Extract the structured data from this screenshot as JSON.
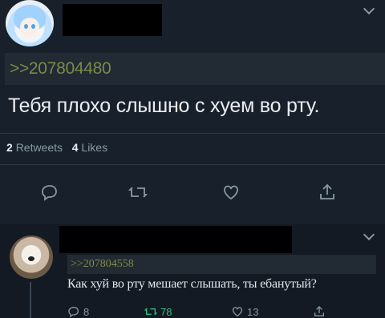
{
  "main_tweet": {
    "quote_ref": ">>207804480",
    "text": "Тебя плохо слышно с хуем во рту.",
    "retweets_count": "2",
    "retweets_label": "Retweets",
    "likes_count": "4",
    "likes_label": "Likes"
  },
  "reply_tweet": {
    "quote_ref": ">>207804558",
    "text": "Как хуй во рту мешает слышать, ты ебанутый?",
    "reply_count": "8",
    "retweet_count": "78",
    "like_count": "13"
  },
  "colors": {
    "background": "#141c26",
    "quote_green": "#7a8a48",
    "muted": "#8899a6"
  }
}
